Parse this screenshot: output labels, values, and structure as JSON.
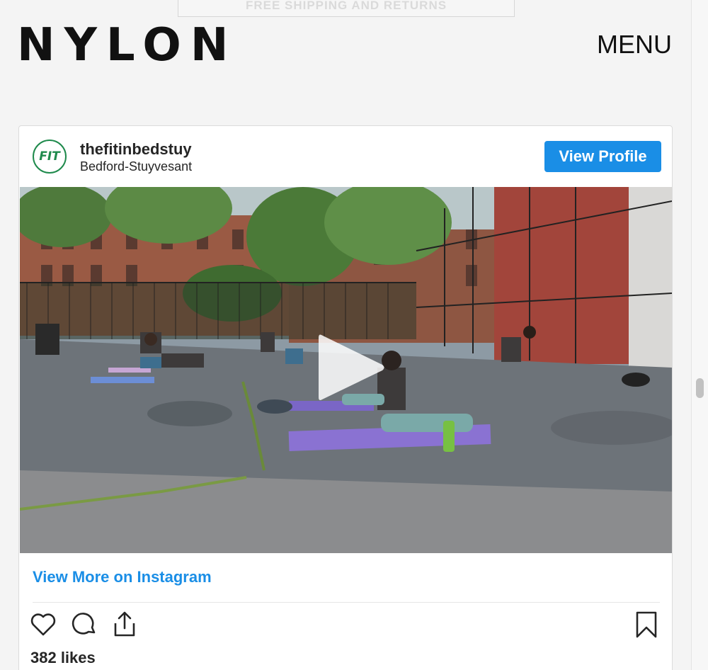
{
  "banner": {
    "text": "FREE SHIPPING AND RETURNS"
  },
  "header": {
    "logo": "NYLON",
    "menu_label": "MENU"
  },
  "post": {
    "avatar_text": "FIT",
    "username": "thefitinbedstuy",
    "location": "Bedford-Stuyvesant",
    "view_profile_label": "View Profile",
    "view_more_label": "View More on Instagram",
    "likes": "382 likes"
  },
  "icons": [
    "heart-icon",
    "comment-icon",
    "share-icon",
    "bookmark-icon",
    "play-icon"
  ],
  "colors": {
    "accent": "#1a8ee6",
    "brand_green": "#1f8a4c",
    "text": "#262626"
  }
}
